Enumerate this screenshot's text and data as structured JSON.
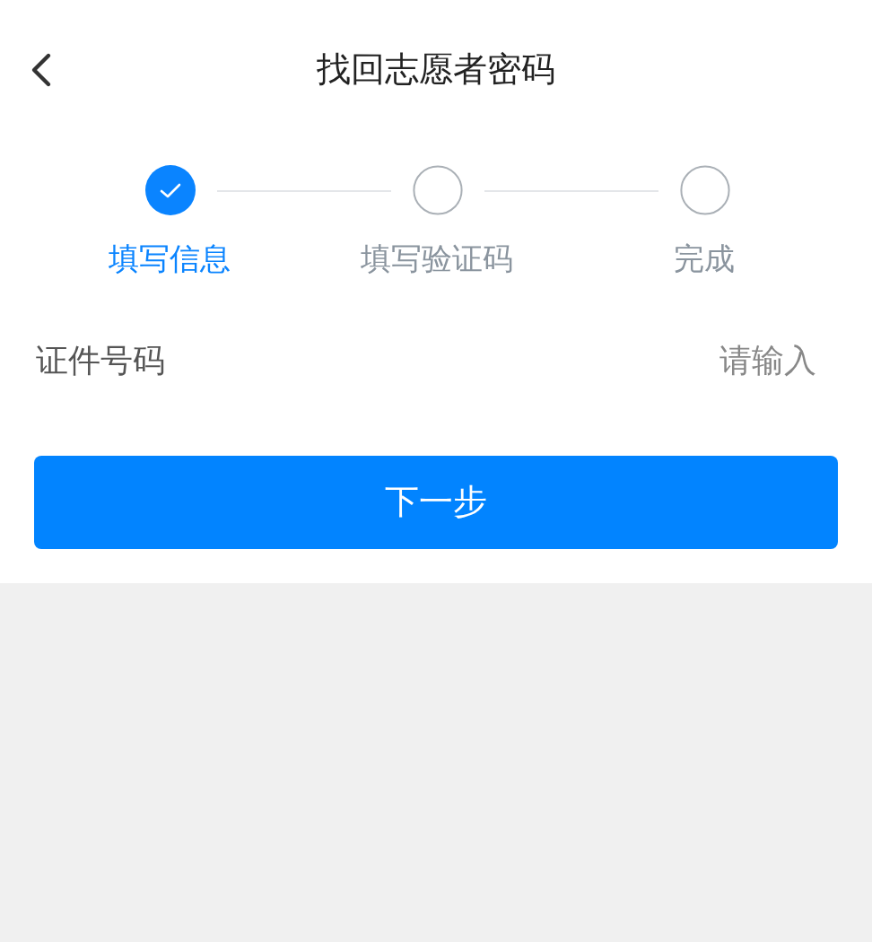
{
  "header": {
    "title": "找回志愿者密码"
  },
  "steps": [
    {
      "label": "填写信息",
      "completed": true
    },
    {
      "label": "填写验证码",
      "completed": false
    },
    {
      "label": "完成",
      "completed": false
    }
  ],
  "field": {
    "label": "证件号码",
    "placeholder": "请输入"
  },
  "button": "下一步"
}
